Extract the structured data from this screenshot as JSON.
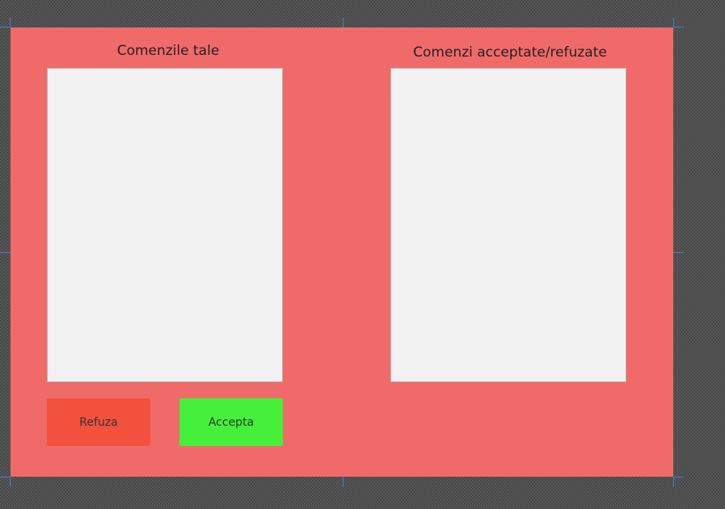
{
  "form": {
    "left_title": "Comenzile tale",
    "right_title": "Comenzi acceptate/refuzate",
    "refuza_label": "Refuza",
    "accepta_label": "Accepta"
  },
  "colors": {
    "canvas": "#f16a6a",
    "listbox": "#f2f2f2",
    "refuza": "#f2513e",
    "accepta": "#45f03a"
  }
}
